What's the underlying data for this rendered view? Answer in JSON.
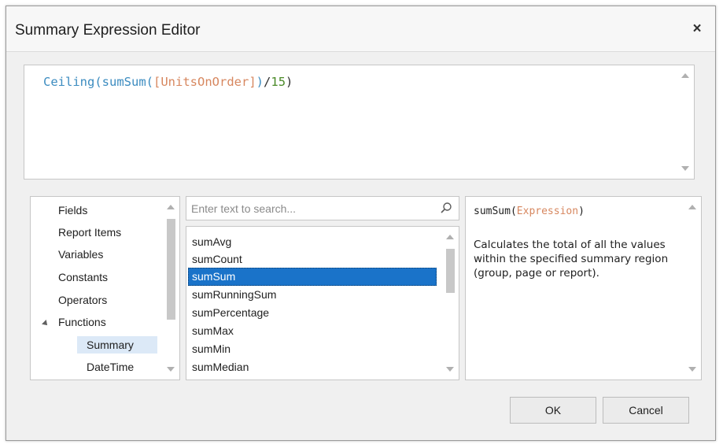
{
  "dialog": {
    "title": "Summary Expression Editor",
    "close_label": "×"
  },
  "expression": {
    "func1": "Ceiling",
    "paren_open1": "(",
    "func2": "sumSum",
    "paren_open2": "(",
    "field": "[UnitsOnOrder]",
    "paren_close": "])",
    "op": "/",
    "number": "15",
    "paren_close2": ")"
  },
  "categories": {
    "items": [
      "Fields",
      "Report Items",
      "Variables",
      "Constants",
      "Operators",
      "Functions"
    ],
    "sub_items": [
      "Summary",
      "DateTime"
    ],
    "selected": "Summary",
    "expanded": "Functions"
  },
  "search": {
    "placeholder": "Enter text to search..."
  },
  "functions": {
    "items": [
      "sumAvg",
      "sumCount",
      "sumSum",
      "sumRunningSum",
      "sumPercentage",
      "sumMax",
      "sumMin",
      "sumMedian"
    ],
    "selected": "sumSum"
  },
  "description": {
    "signature_name": "sumSum",
    "signature_open": "(",
    "signature_param": "Expression",
    "signature_close": ")",
    "text": "Calculates the total of all the values within the specified summary region (group, page or report)."
  },
  "buttons": {
    "ok_label": "OK",
    "cancel_label": "Cancel"
  },
  "colors": {
    "function": "#3c8cc0",
    "field": "#d7875f",
    "number": "#4a8a28",
    "selection": "#1a73c9"
  }
}
